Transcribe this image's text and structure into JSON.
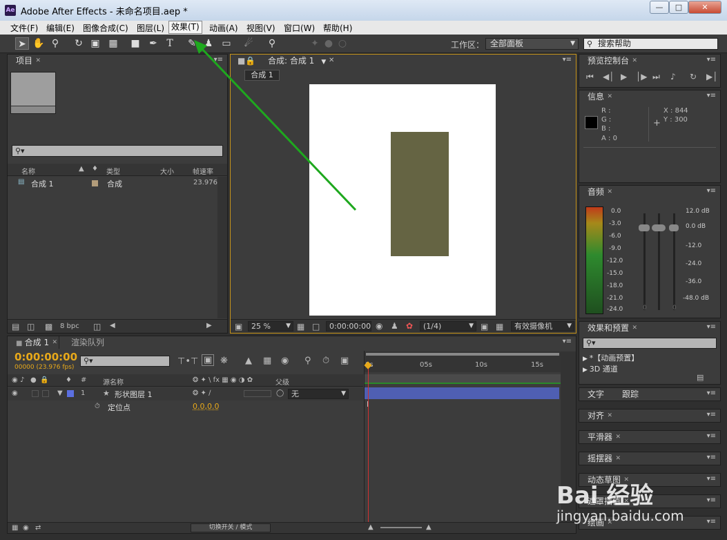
{
  "window": {
    "title": "Adobe After Effects - 未命名项目.aep *",
    "app_icon": "Ae"
  },
  "menu": [
    "文件(F)",
    "编辑(E)",
    "图像合成(C)",
    "图层(L)",
    "效果(T)",
    "动画(A)",
    "视图(V)",
    "窗口(W)",
    "帮助(H)"
  ],
  "toolbar": {
    "workspace_label": "工作区：",
    "workspace_value": "全部面板",
    "help_placeholder": "搜索帮助"
  },
  "project": {
    "tab": "项目",
    "columns": [
      "名称",
      "类型",
      "大小",
      "帧速率"
    ],
    "items": [
      {
        "name": "合成 1",
        "type": "合成",
        "fps": "23.976"
      }
    ],
    "bpc": "8 bpc"
  },
  "composition": {
    "tab": "合成: 合成 1",
    "breadcrumb": "合成 1",
    "zoom": "25 %",
    "timecode": "0:00:00:00",
    "resolution": "(1/4)",
    "camera": "有效摄像机",
    "shape_color": "#656443"
  },
  "preview": {
    "tab": "预览控制台"
  },
  "info": {
    "tab": "信息",
    "r": "R :",
    "g": "G :",
    "b": "B :",
    "a": "A : 0",
    "x": "X : 844",
    "y": "Y : 300"
  },
  "audio": {
    "tab": "音频",
    "left_scale": [
      "0.0",
      "-3.0",
      "-6.0",
      "-9.0",
      "-12.0",
      "-15.0",
      "-18.0",
      "-21.0",
      "-24.0"
    ],
    "right_scale": [
      "12.0 dB",
      "0.0 dB",
      "-12.0",
      "-24.0",
      "-36.0",
      "-48.0 dB"
    ],
    "zero_left": "0",
    "zero_right": "0"
  },
  "effects": {
    "tab": "效果和预置",
    "items": [
      "*【动画预置】",
      "3D 通道"
    ]
  },
  "side_tabs": [
    "文字",
    "跟踪",
    "对齐",
    "平滑器",
    "摇摆器",
    "动态草图",
    "遮罩插值",
    "绘画"
  ],
  "timeline": {
    "tabs": [
      "合成 1",
      "渲染队列"
    ],
    "timecode": "0:00:00:00",
    "fps_info": "00000 (23.976 fps)",
    "col_source": "源名称",
    "col_parent": "父级",
    "ruler": [
      "0s",
      "05s",
      "10s",
      "15s"
    ],
    "layers": [
      {
        "index": "1",
        "name": "形状图层 1",
        "parent": "无",
        "label_color": "#5b6fe0"
      }
    ],
    "property": {
      "name": "定位点",
      "value": "0.0,0.0"
    },
    "bottom_toggle": "切换开关 / 模式"
  },
  "watermark": {
    "brand": "Bai 经验",
    "url": "jingyan.baidu.com"
  },
  "annotation_color": "#1ea81e"
}
